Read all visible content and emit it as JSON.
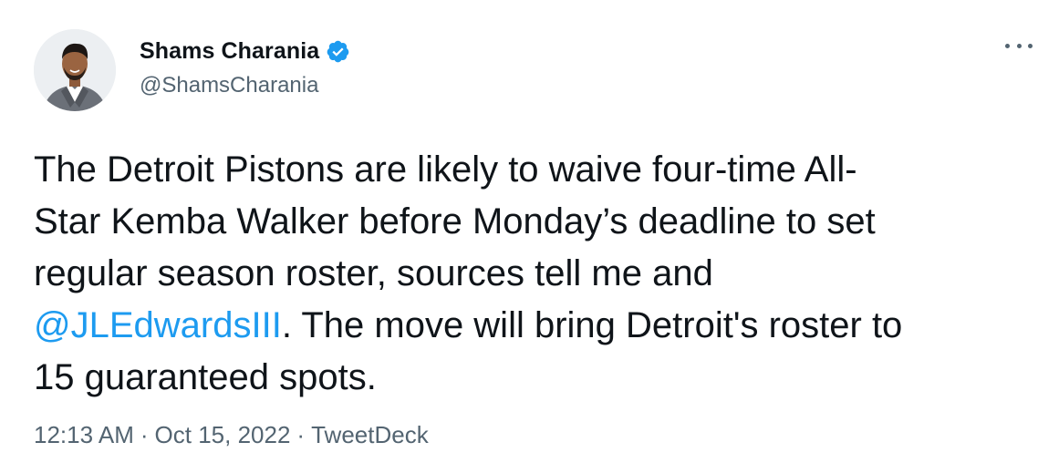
{
  "author": {
    "display_name": "Shams Charania",
    "handle": "@ShamsCharania",
    "verified": true,
    "avatar_icon": "profile-photo"
  },
  "tweet": {
    "lines": [
      "The Detroit Pistons are likely to waive four-time All-",
      "Star Kemba Walker before Monday’s deadline to set",
      "regular season roster, sources tell me and"
    ],
    "mention": "@JLEdwardsIII",
    "after_mention": ". The move will bring Detroit's roster to",
    "last_line": "15 guaranteed spots."
  },
  "meta": {
    "time": "12:13 AM",
    "separator": "·",
    "date": "Oct 15, 2022",
    "source": "TweetDeck"
  },
  "colors": {
    "text": "#0f1419",
    "secondary": "#536471",
    "accent": "#1d9bf0"
  }
}
